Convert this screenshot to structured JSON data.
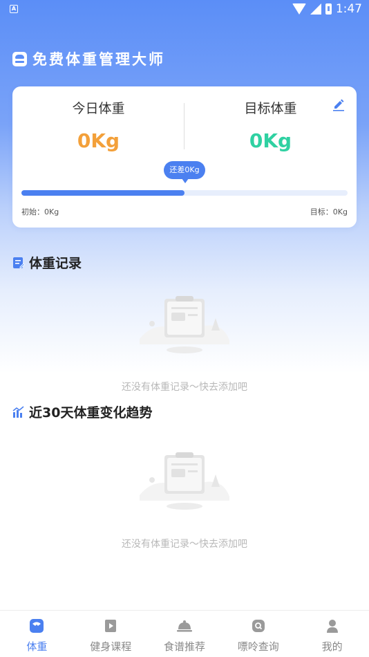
{
  "status_bar": {
    "left_icon": "A",
    "time": "1:47"
  },
  "app": {
    "title": "免费体重管理大师"
  },
  "weight_card": {
    "today_label": "今日体重",
    "today_value": "0Kg",
    "target_label": "目标体重",
    "target_value": "0Kg",
    "diff_label": "还差0Kg",
    "progress_percent": 50,
    "initial_text": "初始：0Kg",
    "target_text": "目标：0Kg"
  },
  "records_section": {
    "title": "体重记录",
    "empty_text": "还没有体重记录～快去添加吧"
  },
  "trend_section": {
    "title": "近30天体重变化趋势",
    "empty_text": "还没有体重记录～快去添加吧"
  },
  "bottom_nav": [
    {
      "label": "体重",
      "icon": "scale-icon",
      "active": true
    },
    {
      "label": "健身课程",
      "icon": "video-icon",
      "active": false
    },
    {
      "label": "食谱推荐",
      "icon": "cloche-icon",
      "active": false
    },
    {
      "label": "嘌呤查询",
      "icon": "search-icon",
      "active": false
    },
    {
      "label": "我的",
      "icon": "user-icon",
      "active": false
    }
  ],
  "colors": {
    "accent": "#4b80f0",
    "today_value": "#f3a03a",
    "target_value": "#2fd1a2",
    "header_gradient_top": "#5b8ef7"
  }
}
